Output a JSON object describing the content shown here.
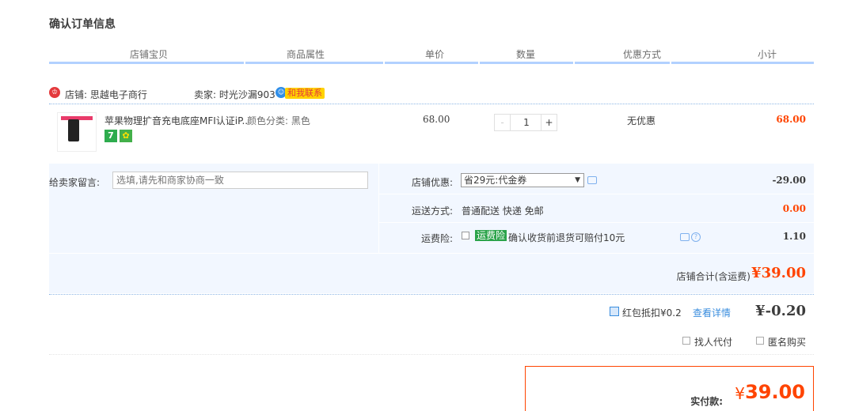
{
  "page": {
    "title": "确认订单信息"
  },
  "columns": [
    "店铺宝贝",
    "商品属性",
    "单价",
    "数量",
    "优惠方式",
    "小计"
  ],
  "shop": {
    "icon_text": "♔",
    "name": "店铺: 思越电子商行",
    "seller": "卖家: 时光沙漏903",
    "contact_label": "和我联系"
  },
  "item": {
    "title": "苹果物理扩音充电底座MFI认证iP..",
    "attr": "颜色分类: 黑色",
    "unit_price": "68.00",
    "quantity": "1",
    "minus": "-",
    "plus": "+",
    "promo": "无优惠",
    "subtotal": "68.00",
    "badge_seven": "7"
  },
  "details": {
    "message_label": "给卖家留言:",
    "message_placeholder": "选填,请先和商家协商一致",
    "shop_discount_label": "店铺优惠:",
    "shop_discount_value": "省29元:代金券",
    "shop_discount_amount": "-29.00",
    "shipping_label": "运送方式:",
    "shipping_value": "普通配送 快递 免邮",
    "shipping_amount": "0.00",
    "insurance_label": "运费险:",
    "insurance_tag": "运费险",
    "insurance_text": "确认收货前退货可赔付10元",
    "insurance_amount": "1.10",
    "shop_total_label": "店铺合计(含运费)",
    "shop_total_value": "¥39.00"
  },
  "redpack": {
    "label": "红包抵扣¥0.2",
    "link": "查看详情",
    "amount": "¥-0.20"
  },
  "options": {
    "proxy_pay": "找人代付",
    "anonymous": "匿名购买"
  },
  "payment": {
    "label": "实付款:",
    "currency": "¥",
    "amount": "39.00"
  },
  "colors": {
    "accent": "#ff4400",
    "header_line": "#b2d1ff",
    "detail_bg": "#f2f7ff",
    "link": "#3a8dde"
  }
}
